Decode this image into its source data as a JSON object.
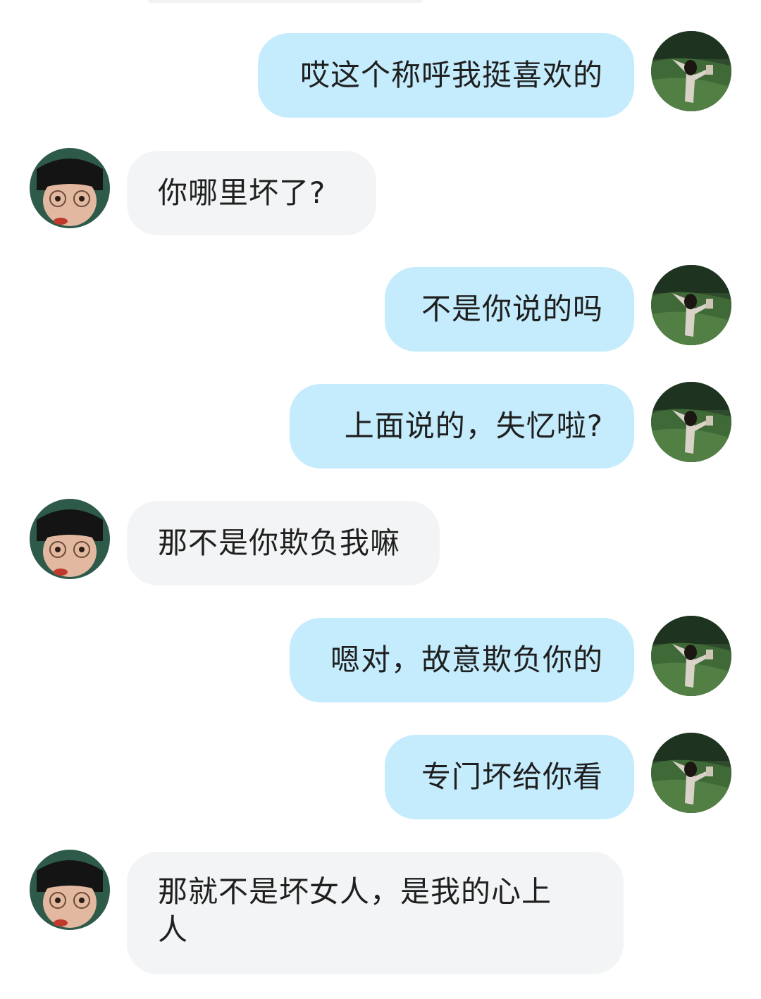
{
  "colors": {
    "my_bubble": "#c5ecfc",
    "their_bubble": "#f3f4f5",
    "text": "#1f1f1f",
    "background": "#ffffff"
  },
  "avatars": {
    "me": "avatar-girl-in-meadow-icon",
    "other": "avatar-boy-with-glasses-icon"
  },
  "messages": [
    {
      "sender": "me",
      "text": "哎这个称呼我挺喜欢的"
    },
    {
      "sender": "other",
      "text": "你哪里坏了?"
    },
    {
      "sender": "me",
      "text": "不是你说的吗"
    },
    {
      "sender": "me",
      "text": "上面说的，失忆啦?"
    },
    {
      "sender": "other",
      "text": "那不是你欺负我嘛"
    },
    {
      "sender": "me",
      "text": "嗯对，故意欺负你的"
    },
    {
      "sender": "me",
      "text": "专门坏给你看"
    },
    {
      "sender": "other",
      "text": "那就不是坏女人，是我的心上人"
    }
  ]
}
